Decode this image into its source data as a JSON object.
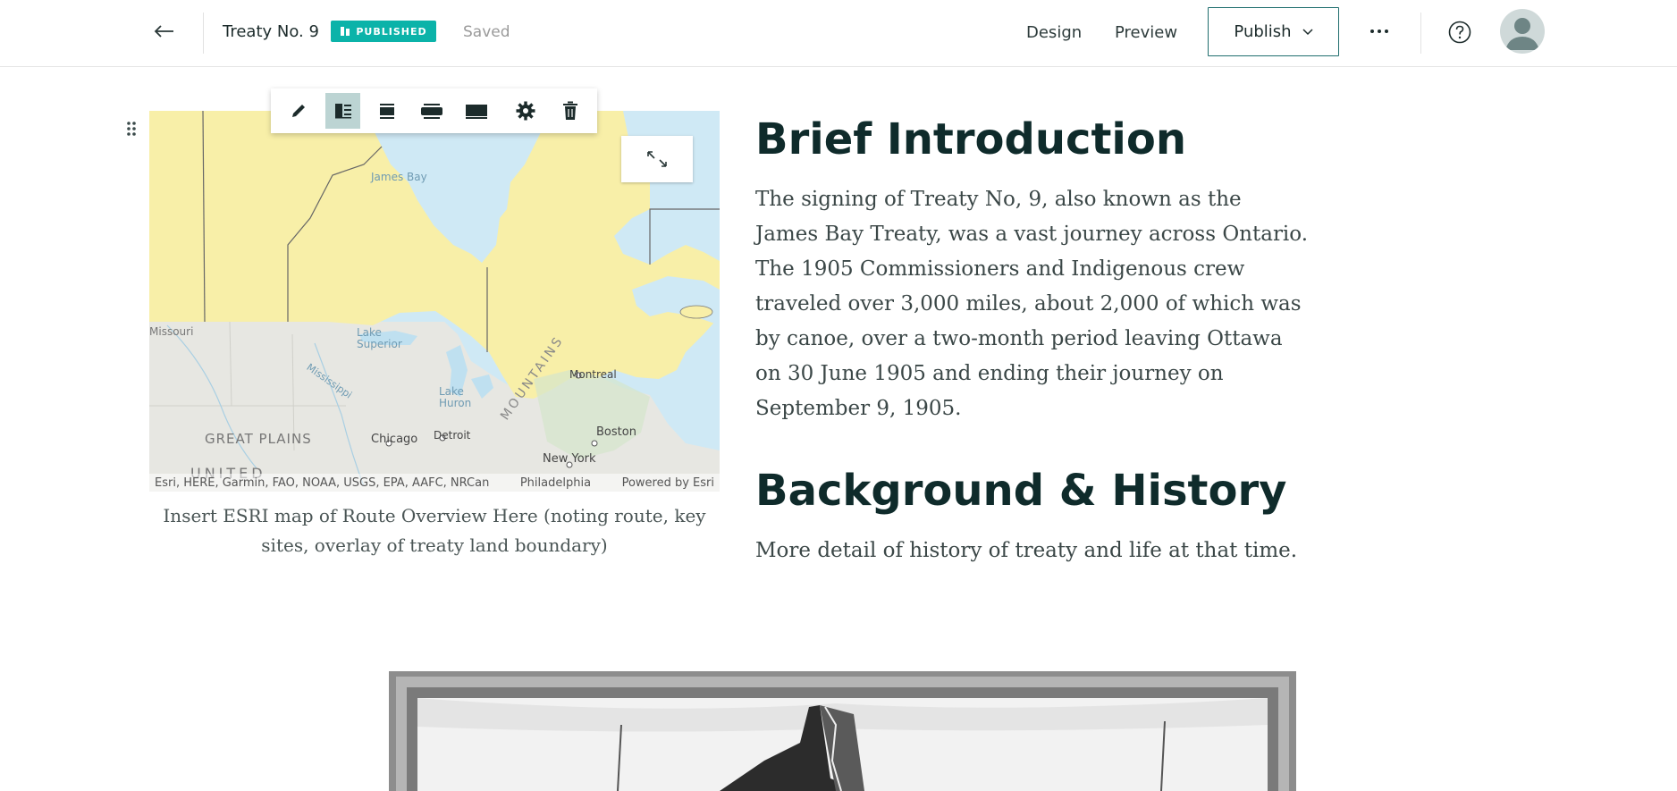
{
  "header": {
    "back_icon": "arrow-left-icon",
    "story_title": "Treaty No. 9",
    "status_badge": "PUBLISHED",
    "save_status": "Saved",
    "nav": {
      "design": "Design",
      "preview": "Preview"
    },
    "publish_label": "Publish",
    "more_label": "···",
    "help_icon": "question-circle-icon",
    "avatar_icon": "user-avatar-icon",
    "accent_color": "#0bb3a9"
  },
  "block_toolbar": {
    "buttons": [
      {
        "icon": "pencil-icon",
        "active": false
      },
      {
        "icon": "float-layout-icon",
        "active": true
      },
      {
        "icon": "standard-width-icon",
        "active": false
      },
      {
        "icon": "wide-width-icon",
        "active": false
      },
      {
        "icon": "full-width-icon",
        "active": false
      },
      {
        "icon": "gear-icon",
        "active": false
      },
      {
        "icon": "trash-icon",
        "active": false
      }
    ]
  },
  "map": {
    "labels": {
      "james_bay": "James Bay",
      "missouri": "Missouri",
      "lake_superior": "Lake Superior",
      "mississippi": "Mississippi",
      "lake_huron": "Lake Huron",
      "great_plains": "GREAT PLAINS",
      "chicago": "Chicago",
      "detroit": "Detroit",
      "mountains": "MOUNTAINS",
      "boston": "Boston",
      "new_york": "New York",
      "montreal": "Montreal",
      "united": "UNITED"
    },
    "attribution": "Esri, HERE, Garmin, FAO, NOAA, USGS, EPA, AAFC, NRCan",
    "attribution_city": "Philadelphia",
    "powered_by": "Powered by Esri",
    "expand_icon": "expand-arrows-icon",
    "caption": "Insert ESRI map of Route Overview Here (noting route, key sites, overlay of treaty land boundary)"
  },
  "content": {
    "section1_heading": "Brief Introduction",
    "section1_body": "The signing of Treaty No, 9, also known as the James Bay Treaty, was a vast journey across Ontario. The 1905 Commissioners and Indigenous crew traveled over 3,000 miles, about 2,000 of which was by canoe, over a two-month period leaving Ottawa on 30 June 1905 and ending their journey on September 9, 1905.",
    "section2_heading": "Background & History",
    "section2_body": "More detail of history of treaty and life at that time."
  },
  "drag_handle_icon": "drag-grip-icon"
}
